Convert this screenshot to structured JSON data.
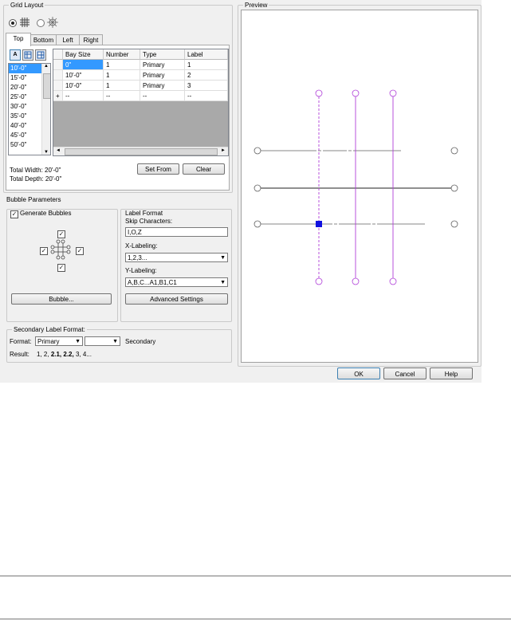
{
  "grid_layout": {
    "title": "Grid Layout",
    "tabs": [
      "Top",
      "Bottom",
      "Left",
      "Right"
    ],
    "active_tab": "Top",
    "bay_sizes": [
      "10'-0\"",
      "15'-0\"",
      "20'-0\"",
      "25'-0\"",
      "30'-0\"",
      "35'-0\"",
      "40'-0\"",
      "45'-0\"",
      "50'-0\""
    ],
    "table": {
      "headers": [
        "Bay Size",
        "Number",
        "Type",
        "Label"
      ],
      "rows": [
        [
          "0\"",
          "1",
          "Primary",
          "1"
        ],
        [
          "10'-0\"",
          "1",
          "Primary",
          "2"
        ],
        [
          "10'-0\"",
          "1",
          "Primary",
          "3"
        ],
        [
          "--",
          "--",
          "--",
          "--"
        ]
      ],
      "new_row_marker": "+"
    },
    "total_width": "Total Width: 20'-0\"",
    "total_depth": "Total Depth: 20'-0\"",
    "set_from_label": "Set From",
    "clear_label": "Clear"
  },
  "bubble": {
    "title": "Bubble Parameters",
    "generate_label": "Generate Bubbles",
    "bubble_button": "Bubble..."
  },
  "label_format": {
    "title": "Label Format",
    "skip_label": "Skip Characters:",
    "skip_value": "I,O,Z",
    "x_label": "X-Labeling:",
    "x_value": "1,2,3...",
    "y_label": "Y-Labeling:",
    "y_value": "A,B,C...A1,B1,C1",
    "advanced_label": "Advanced Settings"
  },
  "secondary": {
    "title": "Secondary Label Format:",
    "format_label": "Format:",
    "format_value": "Primary",
    "second_value": "",
    "secondary_text": "Secondary",
    "result_label": "Result:",
    "result_1": "1, 2,",
    "result_bold": "2.1, 2.2,",
    "result_2": "3, 4..."
  },
  "preview": {
    "title": "Preview",
    "colors": {
      "vertical": "#b040d8",
      "horizontal": "#606060",
      "selected": "#1010e0"
    }
  },
  "footer": {
    "ok": "OK",
    "cancel": "Cancel",
    "help": "Help"
  }
}
